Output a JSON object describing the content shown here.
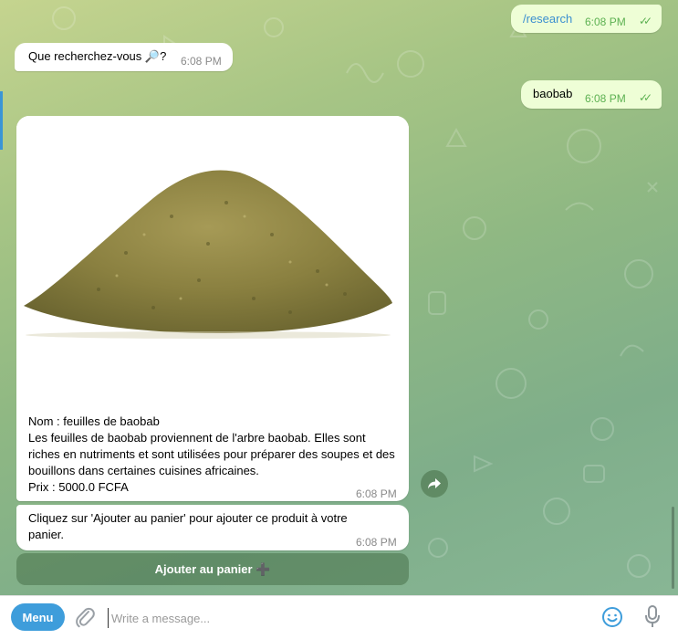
{
  "messages": [
    {
      "text": "/research",
      "time": "6:08 PM",
      "status": "read"
    },
    {
      "text": "Que recherchez-vous 🔎?",
      "time": "6:08 PM"
    },
    {
      "text": "baobab",
      "time": "6:08 PM",
      "status": "read"
    }
  ],
  "product": {
    "name_line": "Nom : feuilles de baobab",
    "description": "Les feuilles de baobab proviennent de l'arbre baobab. Elles sont riches en nutriments et sont utilisées pour préparer des soupes et des bouillons dans certaines cuisines africaines.",
    "price_line": "Prix : 5000.0 FCFA",
    "time": "6:08 PM"
  },
  "instruction": {
    "text": "Cliquez sur 'Ajouter au panier' pour ajouter ce produit à votre panier.",
    "time": "6:08 PM"
  },
  "inline_keyboard": {
    "button_label": "Ajouter au panier ➕"
  },
  "composer": {
    "menu_label": "Menu",
    "placeholder": "Write a message..."
  },
  "colors": {
    "accent": "#3e9ddb",
    "outgoing_bubble": "#eefed6",
    "read_check": "#5db152"
  }
}
